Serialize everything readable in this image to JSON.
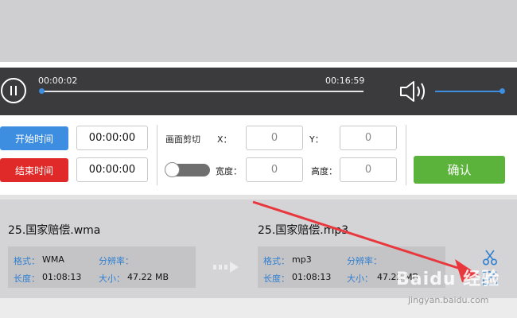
{
  "player": {
    "current_time": "00:00:02",
    "total_time": "00:16:59",
    "progress_fraction": 0.002,
    "volume_fraction": 1.0
  },
  "trim": {
    "start_button": "开始时间",
    "end_button": "结束时间",
    "start_value": "00:00:00",
    "end_value": "00:00:00"
  },
  "crop": {
    "label": "画面剪切",
    "x_label": "X：",
    "y_label": "Y：",
    "width_label": "宽度：",
    "height_label": "高度：",
    "x_value": "0",
    "y_value": "0",
    "width_value": "0",
    "height_value": "0",
    "enabled": false
  },
  "confirm_button": "确认",
  "source_file": {
    "name": "25.国家赔偿.wma",
    "format_label": "格式：",
    "format_value": "WMA",
    "resolution_label": "分辨率：",
    "resolution_value": "",
    "duration_label": "长度：",
    "duration_value": "01:08:13",
    "size_label": "大小：",
    "size_value": "47.22 MB"
  },
  "output_file": {
    "name": "25.国家赔偿.mp3",
    "format_label": "格式：",
    "format_value": "mp3",
    "resolution_label": "分辨率：",
    "resolution_value": "",
    "duration_label": "长度：",
    "duration_value": "01:08:13",
    "size_label": "大小：",
    "size_value": "47.22 MB"
  },
  "icons": {
    "pause": "pause-icon",
    "volume": "volume-icon",
    "convert_arrows": "arrows-right-icon",
    "cut": "scissors-icon",
    "edit": "edit-icon"
  },
  "colors": {
    "accent_blue": "#3d8ee0",
    "danger_red": "#e02a2a",
    "confirm_green": "#5bb33c",
    "player_bg": "#3b3b3d",
    "annotation_red": "#e8383d"
  },
  "watermark": {
    "logo": "Baidu 经验",
    "url": "jingyan.baidu.com"
  }
}
